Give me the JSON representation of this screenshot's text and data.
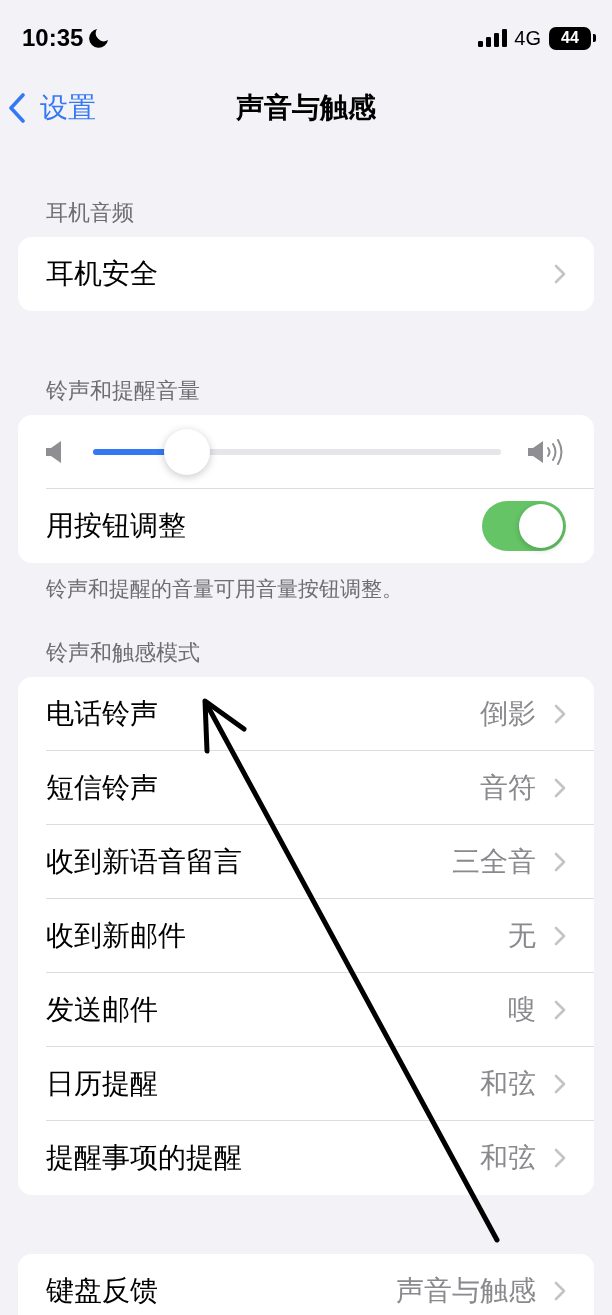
{
  "status_bar": {
    "time": "10:35",
    "network": "4G",
    "battery": "44"
  },
  "nav": {
    "back": "设置",
    "title": "声音与触感"
  },
  "sections": [
    {
      "header": "耳机音频",
      "rows": [
        {
          "kind": "link",
          "label": "耳机安全"
        }
      ]
    },
    {
      "header": "铃声和提醒音量",
      "rows": [
        {
          "kind": "slider",
          "level": 0.23
        },
        {
          "kind": "toggle",
          "label": "用按钮调整",
          "on": true
        }
      ],
      "footer": "铃声和提醒的音量可用音量按钮调整。"
    },
    {
      "header": "铃声和触感模式",
      "rows": [
        {
          "kind": "link",
          "label": "电话铃声",
          "value": "倒影"
        },
        {
          "kind": "link",
          "label": "短信铃声",
          "value": "音符"
        },
        {
          "kind": "link",
          "label": "收到新语音留言",
          "value": "三全音"
        },
        {
          "kind": "link",
          "label": "收到新邮件",
          "value": "无"
        },
        {
          "kind": "link",
          "label": "发送邮件",
          "value": "嗖"
        },
        {
          "kind": "link",
          "label": "日历提醒",
          "value": "和弦"
        },
        {
          "kind": "link",
          "label": "提醒事项的提醒",
          "value": "和弦"
        }
      ]
    },
    {
      "rows": [
        {
          "kind": "link",
          "label": "键盘反馈",
          "value": "声音与触感"
        }
      ]
    }
  ]
}
